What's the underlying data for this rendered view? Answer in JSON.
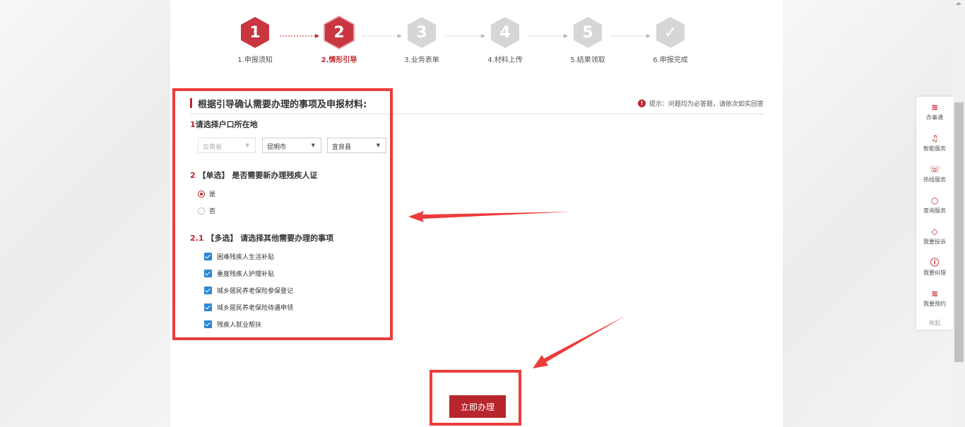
{
  "steps": [
    {
      "num": "1",
      "label": "1.申报须知",
      "state": "done"
    },
    {
      "num": "2",
      "label": "2.情形引导",
      "state": "current"
    },
    {
      "num": "3",
      "label": "3.业务表单",
      "state": "todo"
    },
    {
      "num": "4",
      "label": "4.材料上传",
      "state": "todo"
    },
    {
      "num": "5",
      "label": "5.结果领取",
      "state": "todo"
    },
    {
      "num": "✓",
      "label": "6.申报完成",
      "state": "todo"
    }
  ],
  "section": {
    "title": "根据引导确认需要办理的事项及申报材料:",
    "tip": "提示：问题均为必答题，请依次如实回答"
  },
  "q1": {
    "num": "1",
    "text": "请选择户口所在地",
    "province": "云南省",
    "city": "昆明市",
    "county": "宜良县"
  },
  "q2": {
    "num": "2",
    "text": "【单选】 是否需要新办理残疾人证",
    "options": [
      {
        "label": "是",
        "checked": true
      },
      {
        "label": "否",
        "checked": false
      }
    ]
  },
  "q21": {
    "num": "2.1",
    "text": "【多选】 请选择其他需要办理的事项",
    "options": [
      {
        "label": "困难残疾人生活补贴",
        "checked": true
      },
      {
        "label": "重度残疾人护理补贴",
        "checked": true
      },
      {
        "label": "城乡居民养老保险参保登记",
        "checked": true
      },
      {
        "label": "城乡居民养老保险待遇申领",
        "checked": true
      },
      {
        "label": "残疾人就业帮扶",
        "checked": true
      }
    ]
  },
  "submit_label": "立即办理",
  "rail": {
    "items": [
      {
        "icon": "office-icon",
        "label": "办事通"
      },
      {
        "icon": "headset-icon",
        "label": "智能服务"
      },
      {
        "icon": "phone-icon",
        "label": "热线服务"
      },
      {
        "icon": "search-icon",
        "label": "查询服务"
      },
      {
        "icon": "complaint-icon",
        "label": "我要投诉"
      },
      {
        "icon": "correction-icon",
        "label": "我要纠错"
      },
      {
        "icon": "appointment-icon",
        "label": "我要预约"
      }
    ],
    "collapse": "收起"
  },
  "colors": {
    "accent": "#c0272d",
    "annotation": "#ee3b3b",
    "checkbox": "#2a86d6"
  }
}
